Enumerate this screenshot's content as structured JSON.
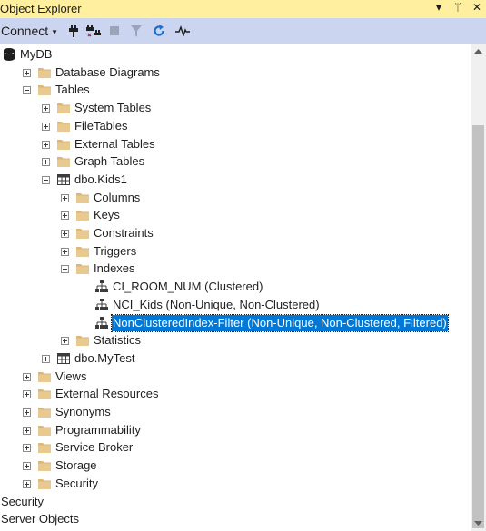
{
  "window": {
    "title": "Object Explorer",
    "controls": [
      "▾",
      "ᛘ",
      "✕"
    ]
  },
  "toolbar": {
    "connect_label": "Connect",
    "buttons": [
      {
        "name": "connect-icon"
      },
      {
        "name": "disconnect-icon"
      },
      {
        "name": "stop-icon"
      },
      {
        "name": "filter-icon"
      },
      {
        "name": "refresh-icon"
      },
      {
        "name": "activity-monitor-icon"
      }
    ]
  },
  "tree": {
    "items": [
      {
        "label": "MyDB",
        "level": 0,
        "expander": "none",
        "icon": "database-icon"
      },
      {
        "label": "Database Diagrams",
        "level": 1,
        "expander": "plus",
        "icon": "folder-icon"
      },
      {
        "label": "Tables",
        "level": 1,
        "expander": "minus",
        "icon": "folder-icon"
      },
      {
        "label": "System Tables",
        "level": 2,
        "expander": "plus",
        "icon": "folder-icon"
      },
      {
        "label": "FileTables",
        "level": 2,
        "expander": "plus",
        "icon": "folder-icon"
      },
      {
        "label": "External Tables",
        "level": 2,
        "expander": "plus",
        "icon": "folder-icon"
      },
      {
        "label": "Graph Tables",
        "level": 2,
        "expander": "plus",
        "icon": "folder-icon"
      },
      {
        "label": "dbo.Kids1",
        "level": 2,
        "expander": "minus",
        "icon": "table-icon"
      },
      {
        "label": "Columns",
        "level": 3,
        "expander": "plus",
        "icon": "folder-icon"
      },
      {
        "label": "Keys",
        "level": 3,
        "expander": "plus",
        "icon": "folder-icon"
      },
      {
        "label": "Constraints",
        "level": 3,
        "expander": "plus",
        "icon": "folder-icon"
      },
      {
        "label": "Triggers",
        "level": 3,
        "expander": "plus",
        "icon": "folder-icon"
      },
      {
        "label": "Indexes",
        "level": 3,
        "expander": "minus",
        "icon": "folder-icon"
      },
      {
        "label": "CI_ROOM_NUM (Clustered)",
        "level": 4,
        "expander": "none",
        "icon": "index-icon"
      },
      {
        "label": "NCI_Kids (Non-Unique, Non-Clustered)",
        "level": 4,
        "expander": "none",
        "icon": "index-icon"
      },
      {
        "label": "NonClusteredIndex-Filter (Non-Unique, Non-Clustered, Filtered)",
        "level": 4,
        "expander": "none",
        "icon": "index-icon",
        "selected": true
      },
      {
        "label": "Statistics",
        "level": 3,
        "expander": "plus",
        "icon": "folder-icon"
      },
      {
        "label": "dbo.MyTest",
        "level": 2,
        "expander": "plus",
        "icon": "table-icon"
      },
      {
        "label": "Views",
        "level": 1,
        "expander": "plus",
        "icon": "folder-icon"
      },
      {
        "label": "External Resources",
        "level": 1,
        "expander": "plus",
        "icon": "folder-icon"
      },
      {
        "label": "Synonyms",
        "level": 1,
        "expander": "plus",
        "icon": "folder-icon"
      },
      {
        "label": "Programmability",
        "level": 1,
        "expander": "plus",
        "icon": "folder-icon"
      },
      {
        "label": "Service Broker",
        "level": 1,
        "expander": "plus",
        "icon": "folder-icon"
      },
      {
        "label": "Storage",
        "level": 1,
        "expander": "plus",
        "icon": "folder-icon"
      },
      {
        "label": "Security",
        "level": 1,
        "expander": "plus",
        "icon": "folder-icon"
      },
      {
        "label": "Security",
        "level": 0,
        "expander": "none",
        "icon": "none",
        "outdent": true
      },
      {
        "label": "Server Objects",
        "level": 0,
        "expander": "none",
        "icon": "none",
        "outdent": true
      }
    ]
  },
  "colors": {
    "titlebar": "#ffef9f",
    "toolbar": "#ccd5f0",
    "selection": "#0078d7",
    "folder": "#dcb67a"
  }
}
